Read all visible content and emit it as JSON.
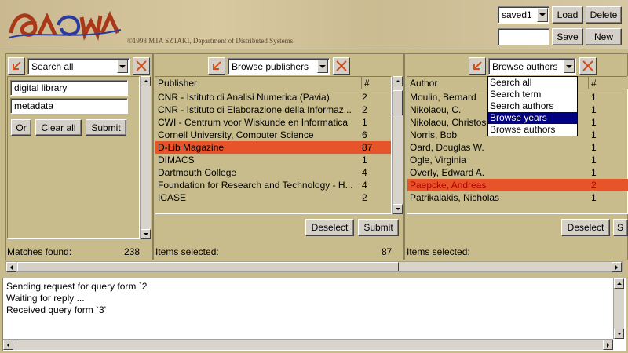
{
  "header": {
    "logo_text": "AQUA",
    "credit": "©1998 MTA SZTAKI, Department of Distributed Systems",
    "saved_select": "saved1",
    "load_label": "Load",
    "delete_label": "Delete",
    "name_value": "",
    "save_label": "Save",
    "new_label": "New"
  },
  "search_panel": {
    "mode": "Search all",
    "terms": [
      "digital library",
      "metadata"
    ],
    "or_label": "Or",
    "clear_label": "Clear all",
    "submit_label": "Submit",
    "matches_label": "Matches found:",
    "matches_count": "238"
  },
  "publishers_panel": {
    "mode": "Browse publishers",
    "col_name": "Publisher",
    "col_count": "#",
    "rows": [
      {
        "name": "CNR - Istituto di Analisi Numerica (Pavia)",
        "count": "2"
      },
      {
        "name": "CNR - Istituto di Elaborazione della Informaz...",
        "count": "2"
      },
      {
        "name": "CWI - Centrum voor Wiskunde en Informatica",
        "count": "1"
      },
      {
        "name": "Cornell University, Computer Science",
        "count": "6"
      },
      {
        "name": "D-Lib Magazine",
        "count": "87"
      },
      {
        "name": "DIMACS",
        "count": "1"
      },
      {
        "name": "Dartmouth College",
        "count": "4"
      },
      {
        "name": "Foundation for Research and Technology - H...",
        "count": "4"
      },
      {
        "name": "ICASE",
        "count": "2"
      }
    ],
    "deselect_label": "Deselect",
    "submit_label": "Submit",
    "items_label": "Items selected:",
    "items_count": "87"
  },
  "authors_panel": {
    "mode": "Browse authors",
    "col_name": "Author",
    "col_count": "#",
    "rows": [
      {
        "name": "Moulin, Bernard",
        "count": "1"
      },
      {
        "name": "Nikolaou, C.",
        "count": "1"
      },
      {
        "name": "Nikolaou, Christos",
        "count": "1"
      },
      {
        "name": "Norris, Bob",
        "count": "1"
      },
      {
        "name": "Oard, Douglas W.",
        "count": "1"
      },
      {
        "name": "Ogle, Virginia",
        "count": "1"
      },
      {
        "name": "Overly, Edward A.",
        "count": "1"
      },
      {
        "name": "Paepcke, Andreas",
        "count": "2"
      },
      {
        "name": "Patrikalakis, Nicholas",
        "count": "1"
      }
    ],
    "deselect_label": "Deselect",
    "submit_label": "S",
    "items_label": "Items selected:",
    "dropdown_options": [
      "Search all",
      "Search term",
      "Search authors",
      "Browse years",
      "Browse authors"
    ]
  },
  "log": {
    "lines": [
      "Sending request for query form `2'",
      "Waiting for reply ...",
      "Received query form `3'"
    ]
  },
  "colors": {
    "panel_bg": "#c8bc8c",
    "selection": "#e8542a",
    "menu_highlight": "#000080"
  }
}
